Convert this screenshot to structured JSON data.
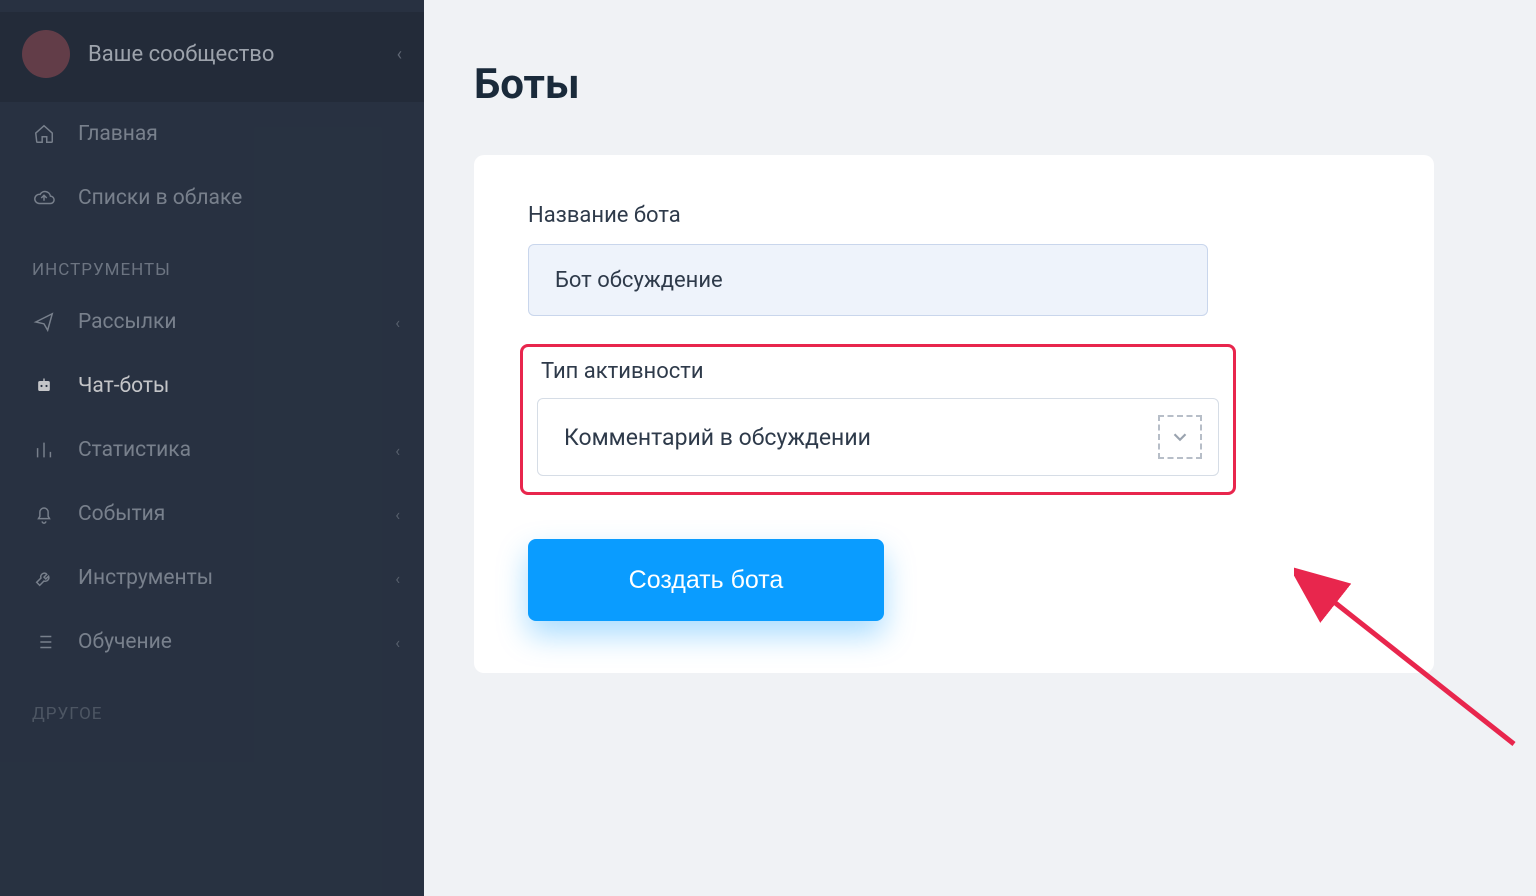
{
  "sidebar": {
    "community": {
      "title": "Ваше сообщество"
    },
    "top_items": [
      {
        "label": "Главная"
      },
      {
        "label": "Списки в облаке"
      }
    ],
    "section_tools": "ИНСТРУМЕНТЫ",
    "tools_items": [
      {
        "label": "Рассылки",
        "expandable": true
      },
      {
        "label": "Чат-боты",
        "active": true
      },
      {
        "label": "Статистика",
        "expandable": true
      },
      {
        "label": "События",
        "expandable": true
      },
      {
        "label": "Инструменты",
        "expandable": true
      },
      {
        "label": "Обучение",
        "expandable": true
      }
    ],
    "section_other": "ДРУГОЕ"
  },
  "main": {
    "title": "Боты",
    "form": {
      "name_label": "Название бота",
      "name_value": "Бот обсуждение",
      "activity_label": "Тип активности",
      "activity_value": "Комментарий в обсуждении",
      "submit_label": "Создать бота"
    }
  },
  "colors": {
    "highlight": "#e8264d",
    "primary": "#0a9cff"
  }
}
